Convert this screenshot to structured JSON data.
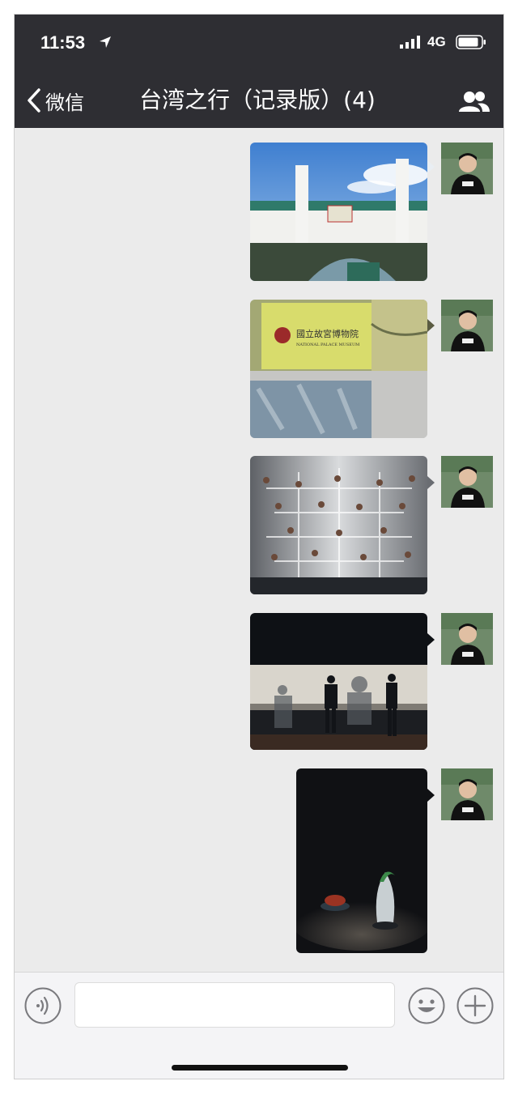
{
  "status_bar": {
    "time": "11:53",
    "network": "4G",
    "icons": [
      "location-arrow-icon",
      "signal-bars-icon",
      "battery-icon"
    ]
  },
  "nav": {
    "back_label": "微信",
    "title": "台湾之行（记录版）(4)",
    "members_icon": "group-members-icon"
  },
  "messages": [
    {
      "type": "image",
      "sender": "self",
      "content": "Palace Museum gateway arch"
    },
    {
      "type": "image",
      "sender": "self",
      "content": "國立故宮博物院 NATIONAL PALACE MUSEUM sign"
    },
    {
      "type": "image",
      "sender": "self",
      "content": "Snuff bottles display case"
    },
    {
      "type": "image",
      "sender": "self",
      "content": "Visitors at exhibition case"
    },
    {
      "type": "image",
      "sender": "self",
      "content": "Jadeite cabbage exhibit"
    }
  ],
  "input_bar": {
    "voice_icon": "voice-input-icon",
    "emoji_icon": "emoji-icon",
    "plus_icon": "plus-icon",
    "placeholder": ""
  },
  "colors": {
    "header_bg": "#2e2e33",
    "chat_bg": "#ebebeb",
    "input_bar_bg": "#f4f4f6"
  }
}
